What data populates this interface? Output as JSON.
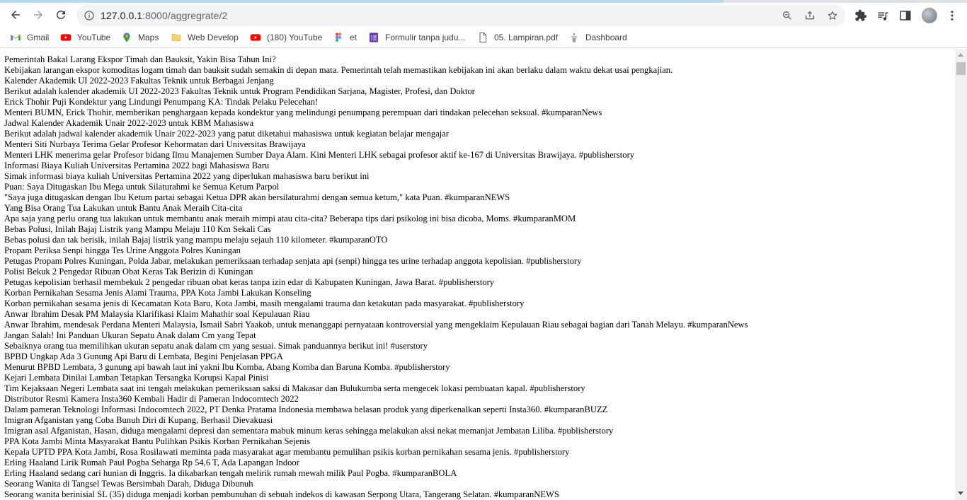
{
  "browser": {
    "url_host": "127.0.0.1",
    "url_path": ":8000/aggregrate/2"
  },
  "bookmarks": [
    {
      "label": "Gmail",
      "icon": "gmail-icon"
    },
    {
      "label": "YouTube",
      "icon": "youtube-icon"
    },
    {
      "label": "Maps",
      "icon": "maps-icon"
    },
    {
      "label": "Web Develop",
      "icon": "folder-icon"
    },
    {
      "label": "(180) YouTube",
      "icon": "youtube-icon"
    },
    {
      "label": "et",
      "icon": "figma-icon"
    },
    {
      "label": "Formulir tanpa judu...",
      "icon": "google-forms-icon"
    },
    {
      "label": "05. Lampiran.pdf",
      "icon": "document-icon"
    },
    {
      "label": "Dashboard",
      "icon": "dashboard-icon"
    }
  ],
  "content": {
    "lines": [
      "Pemerintah Bakal Larang Ekspor Timah dan Bauksit, Yakin Bisa Tahun Ini?",
      "Kebijakan larangan ekspor komoditas logam timah dan bauksit sudah semakin di depan mata. Pemerintah telah memastikan kebijakan ini akan berlaku dalam waktu dekat usai pengkajian.",
      "Kalender Akademik UI 2022-2023 Fakultas Teknik untuk Berbagai Jenjang",
      "Berikut adalah kalender akademik UI 2022-2023 Fakultas Teknik untuk Program Pendidikan Sarjana, Magister, Profesi, dan Doktor",
      "Erick Thohir Puji Kondektur yang Lindungi Penumpang KA: Tindak Pelaku Pelecehan!",
      "Menteri BUMN, Erick Thohir, memberikan penghargaan kepada kondektur yang melindungi penumpang perempuan dari tindakan pelecehan seksual. #kumparanNews",
      "Jadwal Kalender Akademik Unair 2022-2023 untuk KBM Mahasiswa",
      "Berikut adalah jadwal kalender akademik Unair 2022-2023 yang patut diketahui mahasiswa untuk kegiatan belajar mengajar",
      "Menteri Siti Nurbaya Terima Gelar Profesor Kehormatan dari Universitas Brawijaya",
      "Menteri LHK menerima gelar Profesor bidang Ilmu Manajemen Sumber Daya Alam. Kini Menteri LHK sebagai profesor aktif ke-167 di Universitas Brawijaya. #publisherstory",
      "Informasi Biaya Kuliah Universitas Pertamina 2022 bagi Mahasiswa Baru",
      "Simak informasi biaya kuliah Universitas Pertamina 2022 yang diperlukan mahasiswa baru berikut ini",
      "Puan: Saya Ditugaskan Ibu Mega untuk Silaturahmi ke Semua Ketum Parpol",
      "\"Saya juga ditugaskan dengan Ibu Ketum partai sebagai Ketua DPR akan bersilaturahmi dengan semua ketum,\" kata Puan. #kumparanNEWS",
      "Yang Bisa Orang Tua Lakukan untuk Bantu Anak Meraih Cita-cita",
      "Apa saja yang perlu orang tua lakukan untuk membantu anak meraih mimpi atau cita-cita? Beberapa tips dari psikolog ini bisa dicoba, Moms. #kumparanMOM",
      "Bebas Polusi, Inilah Bajaj Listrik yang Mampu Melaju 110 Km Sekali Cas",
      "Bebas polusi dan tak berisik, inilah Bajaj listrik yang mampu melaju sejauh 110 kilometer. #kumparanOTO",
      "Propam Periksa Senpi hingga Tes Urine Anggota Polres Kuningan",
      "Petugas Propam Polres Kuningan, Polda Jabar, melakukan pemeriksaan terhadap senjata api (senpi) hingga tes urine terhadap anggota kepolisian. #publisherstory",
      "Polisi Bekuk 2 Pengedar Ribuan Obat Keras Tak Berizin di Kuningan",
      "Petugas kepolisian berhasil membekuk 2 pengedar ribuan obat keras tanpa izin edar di Kabupaten Kuningan, Jawa Barat. #publisherstory",
      "Korban Pernikahan Sesama Jenis Alami Trauma, PPA Kota Jambi Lakukan Konseling",
      "Korban pernikahan sesama jenis di Kecamatan Kota Baru, Kota Jambi, masih mengalami trauma dan ketakutan pada masyarakat. #publisherstory",
      "Anwar Ibrahim Desak PM Malaysia Klarifikasi Klaim Mahathir soal Kepulauan Riau",
      "Anwar Ibrahim, mendesak Perdana Menteri Malaysia, Ismail Sabri Yaakob, untuk menanggapi pernyataan kontroversial yang mengeklaim Kepulauan Riau sebagai bagian dari Tanah Melayu. #kumparanNews",
      "Jangan Salah! Ini Panduan Ukuran Sepatu Anak dalam Cm yang Tepat",
      "Sebaiknya orang tua memilihkan ukuran sepatu anak dalam cm yang sesuai. Simak panduannya berikut ini! #userstory",
      "BPBD Ungkap Ada 3 Gunung Api Baru di Lembata, Begini Penjelasan PPGA",
      "Menurut BPBD Lembata, 3 gunung api bawah laut ini yakni Ibu Komba, Abang Komba dan Baruna Komba. #publisherstory",
      "Kejari Lembata Dinilai Lamban Tetapkan Tersangka Korupsi Kapal Pinisi",
      "Tim Kejaksaan Negeri Lembata saat ini tengah melakukan pemeriksaan saksi di Makasar dan Bulukumba serta mengecek lokasi pembuatan kapal. #publisherstory",
      "Distributor Resmi Kamera Insta360 Kembali Hadir di Pameran Indocomtech 2022",
      "Dalam pameran Teknologi Informasi Indocomtech 2022, PT Denka Pratama Indonesia membawa belasan produk yang diperkenalkan seperti Insta360. #kumparanBUZZ",
      "Imigran Afganistan yang Coba Bunuh Diri di Kupang, Berhasil Dievakuasi",
      "Imigran asal Afganistan, Hasan, diduga mengalami depresi dan sementara mabuk minum keras sehingga melakukan aksi nekat memanjat Jembatan Liliba. #publisherstory",
      "PPA Kota Jambi Minta Masyarakat Bantu Pulihkan Psikis Korban Pernikahan Sejenis",
      "Kepala UPTD PPA Kota Jambi, Rosa Rosilawati meminta pada masyarakat agar membantu pemulihan psikis korban pernikahan sesama jenis. #publisherstory",
      "Erling Haaland Lirik Rumah Paul Pogba Seharga Rp 54,6 T, Ada Lapangan Indoor",
      "Erling Haaland sedang cari hunian di Inggris. Ia dikabarkan tengah melirik rumah mewah milik Paul Pogba. #kumparanBOLA",
      "Seorang Wanita di Tangsel Tewas Bersimbah Darah, Diduga Dibunuh",
      "Seorang wanita berinisial SL (35) diduga menjadi korban pembunuhan di sebuah indekos di kawasan Serpong Utara, Tangerang Selatan. #kumparanNEWS"
    ]
  }
}
